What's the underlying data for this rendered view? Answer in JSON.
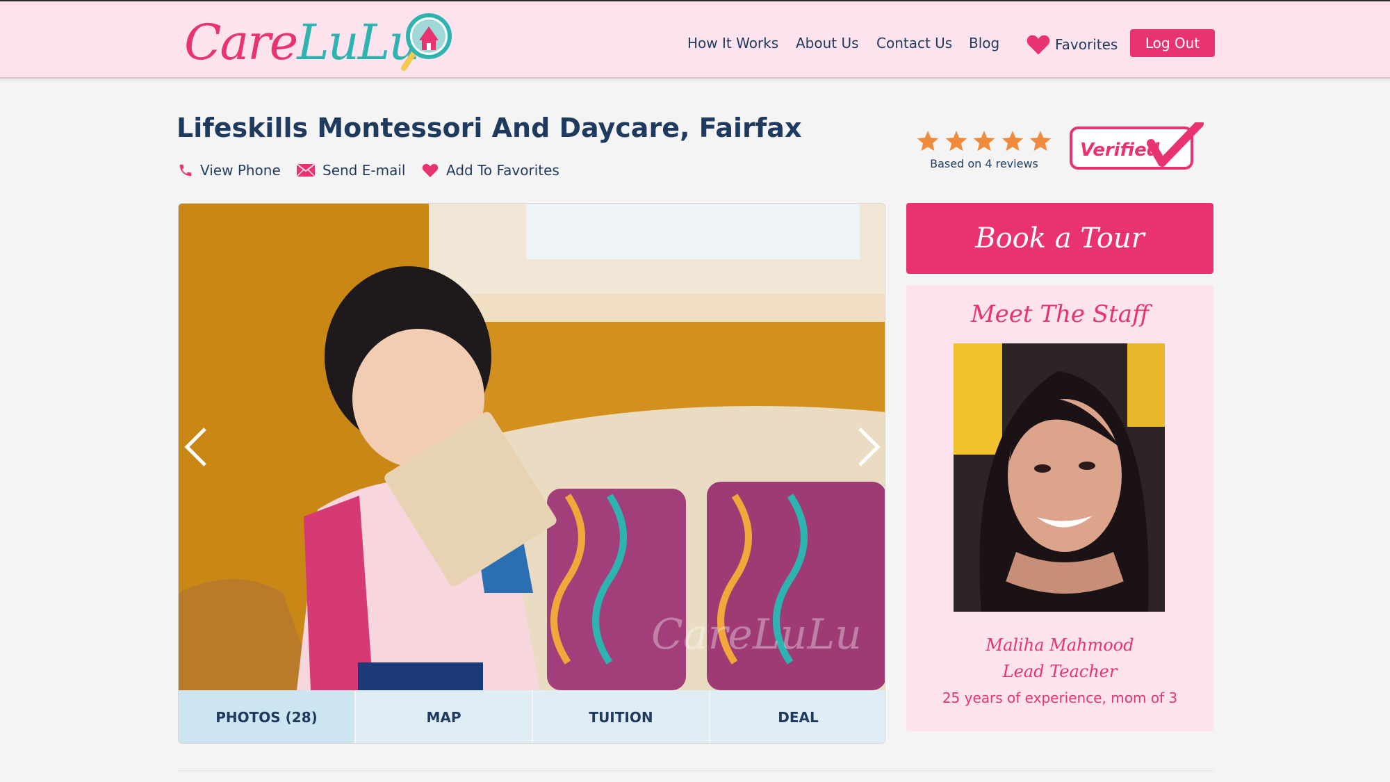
{
  "header": {
    "logo": {
      "part1": "Care",
      "part2": "LuLu"
    },
    "nav": [
      {
        "label": "How It Works"
      },
      {
        "label": "About Us"
      },
      {
        "label": "Contact Us"
      },
      {
        "label": "Blog"
      }
    ],
    "favorites_label": "Favorites",
    "logout_label": "Log Out"
  },
  "listing": {
    "title": "Lifeskills Montessori And Daycare, Fairfax",
    "actions": {
      "phone": "View Phone",
      "email": "Send E-mail",
      "favorite": "Add To Favorites"
    },
    "rating": {
      "stars": 5,
      "caption": "Based on 4 reviews"
    },
    "verified_label": "Verified"
  },
  "gallery": {
    "tabs": [
      {
        "label": "PHOTOS (28)",
        "active": true
      },
      {
        "label": "MAP",
        "active": false
      },
      {
        "label": "TUITION",
        "active": false
      },
      {
        "label": "DEAL",
        "active": false
      }
    ]
  },
  "sidebar": {
    "book_label": "Book a Tour",
    "staff_heading": "Meet The Staff",
    "staff": {
      "name": "Maliha Mahmood",
      "role": "Lead Teacher",
      "description": "25 years of experience, mom of 3"
    }
  },
  "colors": {
    "brand_pink": "#e8336f",
    "brand_teal": "#2eb4b0",
    "navy": "#1f3a5f",
    "header_bg": "#fde3ee",
    "star": "#f08a3c"
  }
}
